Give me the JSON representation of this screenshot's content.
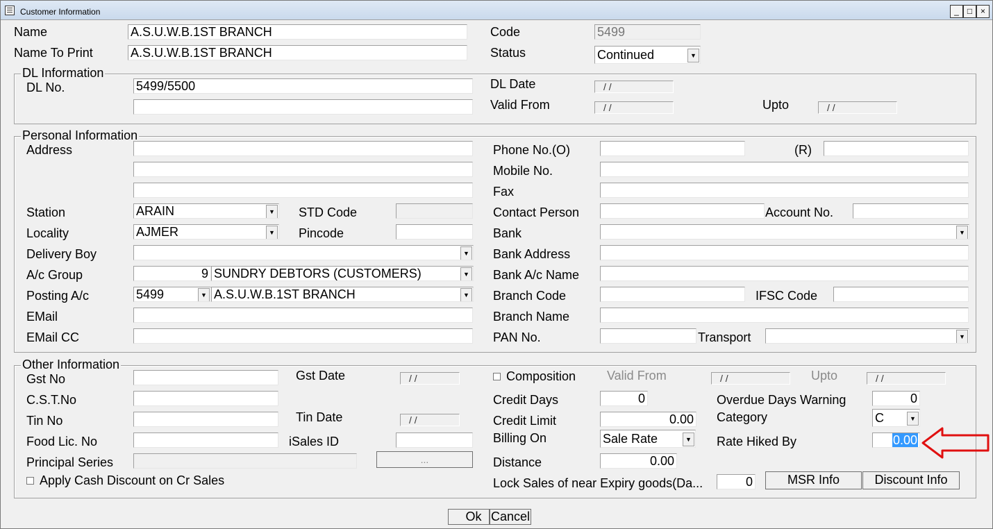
{
  "window": {
    "title": "Customer Information",
    "minimize_glyph": "_",
    "maximize_glyph": "□",
    "close_glyph": "×",
    "icon": "window-menu-icon"
  },
  "header": {
    "name_label": "Name",
    "name_value": "A.S.U.W.B.1ST BRANCH",
    "name_to_print_label": "Name To Print",
    "name_to_print_value": "A.S.U.W.B.1ST BRANCH",
    "code_label": "Code",
    "code_value": "5499",
    "status_label": "Status",
    "status_value": "Continued"
  },
  "dl": {
    "group_label": "DL Information",
    "dl_no_label": "DL No.",
    "dl_no_value": "5499/5500",
    "dl_no_value2": "",
    "dl_date_label": "DL  Date",
    "dl_date_value": "/ /",
    "valid_from_label": "Valid From",
    "valid_from_value": "/ /",
    "upto_label": "Upto",
    "upto_value": "/ /"
  },
  "personal": {
    "group_label": "Personal Information",
    "address_label": "Address",
    "station_label": "Station",
    "station_value": "ARAIN",
    "std_code_label": "STD Code",
    "locality_label": "Locality",
    "locality_value": "AJMER",
    "pincode_label": "Pincode",
    "delivery_boy_label": "Delivery Boy",
    "ac_group_label": "A/c Group",
    "ac_group_code": "9",
    "ac_group_value": "SUNDRY DEBTORS (CUSTOMERS)",
    "posting_label": "Posting A/c",
    "posting_code": "5499",
    "posting_value": "A.S.U.W.B.1ST BRANCH",
    "email_label": "EMail",
    "email_cc_label": "EMail CC",
    "phone_o_label": "Phone No.(O)",
    "phone_r_label": "(R)",
    "mobile_label": "Mobile No.",
    "fax_label": "Fax",
    "contact_person_label": "Contact Person",
    "account_no_label": "Account No.",
    "bank_label": "Bank",
    "bank_address_label": "Bank Address",
    "bank_ac_name_label": "Bank A/c Name",
    "branch_code_label": "Branch Code",
    "ifsc_label": "IFSC Code",
    "branch_name_label": "Branch Name",
    "pan_label": "PAN No.",
    "transport_label": "Transport"
  },
  "other": {
    "group_label": "Other Information",
    "gst_no_label": "Gst No",
    "gst_date_label": "Gst Date",
    "gst_date_value": "/ /",
    "cst_label": "C.S.T.No",
    "tin_label": "Tin No",
    "tin_date_label": "Tin Date",
    "tin_date_value": "/ /",
    "food_lic_label": "Food Lic. No",
    "isales_label": "iSales ID",
    "principal_label": "Principal Series",
    "principal_btn": "...",
    "apply_cash_label": "Apply Cash Discount on Cr Sales",
    "composition_label": "Composition",
    "comp_valid_from_label": "Valid From",
    "comp_valid_from_value": "/ /",
    "comp_upto_label": "Upto",
    "comp_upto_value": "/ /",
    "credit_days_label": "Credit Days",
    "credit_days_value": "0",
    "credit_limit_label": "Credit Limit",
    "credit_limit_value": "0.00",
    "billing_on_label": "Billing On",
    "billing_on_value": "Sale Rate",
    "distance_label": "Distance",
    "distance_value": "0.00",
    "lock_sales_label": "Lock Sales of near Expiry goods(Da...",
    "lock_sales_value": "0",
    "overdue_label": "Overdue Days Warning",
    "overdue_value": "0",
    "category_label": "Category",
    "category_value": "C",
    "rate_hiked_label": "Rate Hiked By",
    "rate_hiked_value": "0.00",
    "msr_btn": "MSR Info",
    "discount_btn": "Discount Info"
  },
  "footer": {
    "ok": "Ok",
    "cancel": "Cancel"
  },
  "colors": {
    "annotation_arrow": "#e01010",
    "selection": "#3399ff"
  }
}
